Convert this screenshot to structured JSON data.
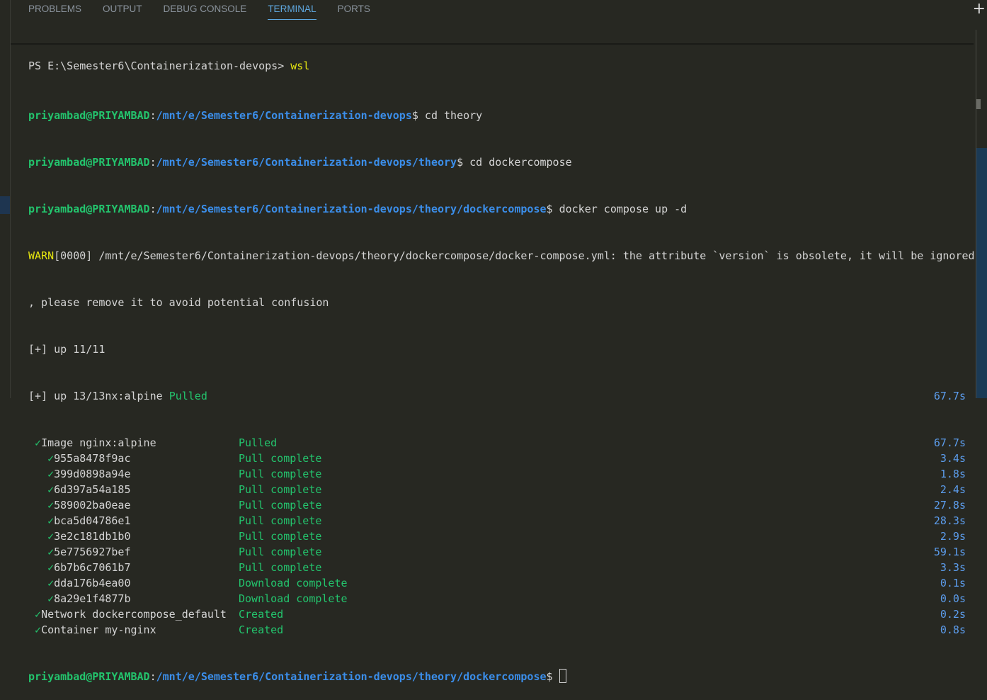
{
  "panel": {
    "tabs": [
      {
        "label": "PROBLEMS",
        "active": false
      },
      {
        "label": "OUTPUT",
        "active": false
      },
      {
        "label": "DEBUG CONSOLE",
        "active": false
      },
      {
        "label": "TERMINAL",
        "active": true
      },
      {
        "label": "PORTS",
        "active": false
      }
    ],
    "new_terminal_icon": "plus-icon"
  },
  "terminal": {
    "ps_prompt": "PS E:\\Semester6\\Containerization-devops> ",
    "ps_command": "wsl",
    "user_host": "priyambad@PRIYAMBAD",
    "commands": [
      {
        "path": "/mnt/e/Semester6/Containerization-devops",
        "cmd": " cd theory"
      },
      {
        "path": "/mnt/e/Semester6/Containerization-devops/theory",
        "cmd": " cd dockercompose"
      },
      {
        "path": "/mnt/e/Semester6/Containerization-devops/theory/dockercompose",
        "cmd": " docker compose up -d"
      }
    ],
    "warn_label": "WARN",
    "warn_text": "[0000] /mnt/e/Semester6/Containerization-devops/theory/dockercompose/docker-compose.yml: the attribute `version` is obsolete, it will be ignored",
    "warn_cont": ", please remove it to avoid potential confusion",
    "progress1": "[+] up 11/11",
    "progress2": "[+] up 13/13nx:alpine ",
    "progress2_status": "Pulled",
    "progress2_time": "67.7s",
    "check": "✓",
    "items": [
      {
        "indent": 1,
        "name": "Image nginx:alpine",
        "status": "Pulled",
        "time": "67.7s"
      },
      {
        "indent": 2,
        "name": "955a8478f9ac",
        "status": "Pull complete",
        "time": "3.4s"
      },
      {
        "indent": 2,
        "name": "399d0898a94e",
        "status": "Pull complete",
        "time": "1.8s"
      },
      {
        "indent": 2,
        "name": "6d397a54a185",
        "status": "Pull complete",
        "time": "2.4s"
      },
      {
        "indent": 2,
        "name": "589002ba0eae",
        "status": "Pull complete",
        "time": "27.8s"
      },
      {
        "indent": 2,
        "name": "bca5d04786e1",
        "status": "Pull complete",
        "time": "28.3s"
      },
      {
        "indent": 2,
        "name": "3e2c181db1b0",
        "status": "Pull complete",
        "time": "2.9s"
      },
      {
        "indent": 2,
        "name": "5e7756927bef",
        "status": "Pull complete",
        "time": "59.1s"
      },
      {
        "indent": 2,
        "name": "6b7b6c7061b7",
        "status": "Pull complete",
        "time": "3.3s"
      },
      {
        "indent": 2,
        "name": "dda176b4ea00",
        "status": "Download complete",
        "time": "0.1s"
      },
      {
        "indent": 2,
        "name": "8a29e1f4877b",
        "status": "Download complete",
        "time": "0.0s"
      },
      {
        "indent": 1,
        "name": "Network dockercompose_default",
        "status": "Created",
        "time": "0.2s"
      },
      {
        "indent": 1,
        "name": "Container my-nginx",
        "status": "Created",
        "time": "0.8s"
      }
    ],
    "final_path": "/mnt/e/Semester6/Containerization-devops/theory/dockercompose"
  }
}
